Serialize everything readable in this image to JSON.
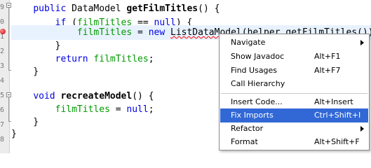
{
  "gutter": {
    "line_numbers": [
      "9",
      "0",
      "1",
      "2",
      "3",
      "4",
      "5",
      "6",
      "7",
      "8",
      "9",
      "0",
      "1"
    ]
  },
  "code": {
    "line1": {
      "indent": "    ",
      "kw_public": "public",
      "type": " DataModel ",
      "method": "getFilmTitles",
      "rest": "() {"
    },
    "line2": {
      "indent": "        ",
      "kw_if": "if",
      "t1": " (",
      "field": "filmTitles",
      "t2": " == ",
      "kw_null": "null",
      "t3": ") {"
    },
    "line3": {
      "indent": "            ",
      "field": "filmTitles",
      "t1": " = ",
      "kw_new": "new",
      "t2": " ",
      "err_class": "ListDataModel",
      "rest": "(helper.getFilmTitles());"
    },
    "line4": {
      "text": "        }"
    },
    "line5": {
      "indent": "        ",
      "kw_return": "return",
      "t1": " ",
      "field": "filmTitles",
      "t2": ";"
    },
    "line6": {
      "text": "    }"
    },
    "line7": {
      "indent": "    ",
      "kw_void": "void",
      "t1": " ",
      "method": "recreateModel",
      "t2": "() {"
    },
    "line8": {
      "indent": "        ",
      "field": "filmTitles",
      "t1": " = ",
      "kw_null": "null",
      "t2": ";"
    },
    "line9": {
      "text": "    }"
    },
    "line10": {
      "text": "}"
    }
  },
  "context_menu": {
    "items": [
      {
        "label": "Navigate",
        "accel": "",
        "submenu": true
      },
      {
        "label": "Show Javadoc",
        "accel": "Alt+F1"
      },
      {
        "label": "Find Usages",
        "accel": "Alt+F7"
      },
      {
        "label": "Call Hierarchy",
        "accel": ""
      },
      {
        "label": "Insert Code...",
        "accel": "Alt+Insert"
      },
      {
        "label": "Fix Imports",
        "accel": "Ctrl+Shift+I",
        "selected": true
      },
      {
        "label": "Refactor",
        "accel": "",
        "submenu": true
      },
      {
        "label": "Format",
        "accel": "Alt+Shift+F"
      }
    ]
  },
  "colors": {
    "keyword": "#0000e6",
    "field": "#009900",
    "current_line": "#e8f2fe",
    "menu_selection": "#3168d5",
    "error_underline": "#ff0000"
  }
}
